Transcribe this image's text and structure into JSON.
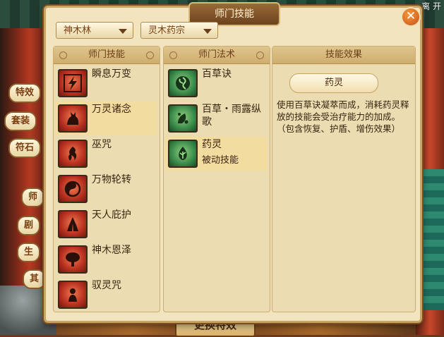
{
  "hud": {
    "top_right": "离 开"
  },
  "side_tabs": [
    "特效",
    "套装",
    "符石",
    "师",
    "剧",
    "生",
    "其"
  ],
  "bottom_button": "更换特效",
  "window": {
    "title": "师门技能",
    "close": "✕"
  },
  "filters": {
    "school": "神木林",
    "sect": "灵木药宗"
  },
  "skills_column": {
    "header": "师门技能",
    "items": [
      {
        "name": "瞬息万变",
        "icon": "lightning-icon",
        "selected": false
      },
      {
        "name": "万灵诸念",
        "icon": "spirit-beast-icon",
        "selected": true
      },
      {
        "name": "巫咒",
        "icon": "curse-flame-icon",
        "selected": false
      },
      {
        "name": "万物轮转",
        "icon": "yin-yang-icon",
        "selected": false
      },
      {
        "name": "天人庇护",
        "icon": "praying-hands-icon",
        "selected": false
      },
      {
        "name": "神木恩泽",
        "icon": "sacred-tree-icon",
        "selected": false
      },
      {
        "name": "驭灵咒",
        "icon": "spirit-figure-icon",
        "selected": false
      }
    ]
  },
  "spells_column": {
    "header": "师门法术",
    "items": [
      {
        "name": "百草诀",
        "sub": "",
        "icon": "herb-swirl-icon",
        "selected": false
      },
      {
        "name": "百草・雨露纵歌",
        "sub": "",
        "icon": "dew-leaf-icon",
        "selected": false
      },
      {
        "name": "药灵",
        "sub": "被动技能",
        "icon": "herb-spirit-icon",
        "selected": true
      }
    ]
  },
  "effect_column": {
    "header": "技能效果",
    "title": "药灵",
    "description": "使用百草诀凝萃而成，消耗药灵释放的技能会受治疗能力的加成。（包含恢复、护盾、增伤效果）"
  },
  "colors": {
    "panel": "#f2e4bf",
    "selected_row": "#f3dc9f",
    "icon_red": "#b7301f",
    "icon_green": "#3b8a4a"
  }
}
